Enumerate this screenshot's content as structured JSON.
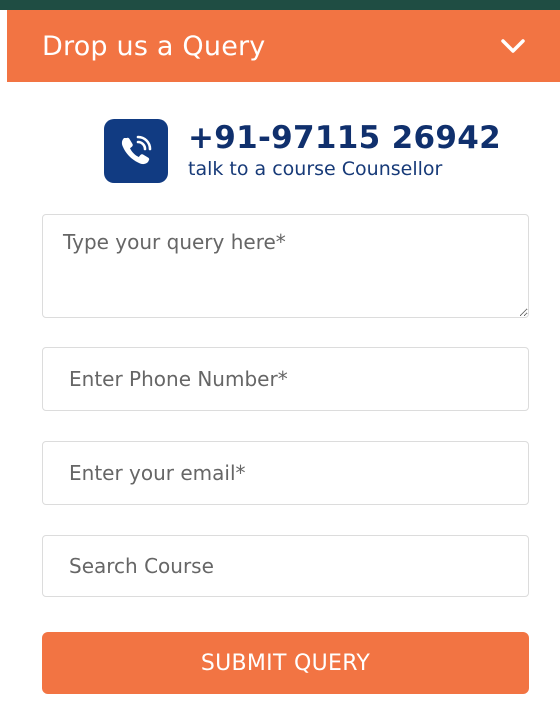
{
  "header": {
    "title": "Drop us a Query",
    "toggle_icon": "chevron-down-icon"
  },
  "contact": {
    "icon": "phone-call-icon",
    "phone_number": "+91-97115 26942",
    "caption": "talk to a course Counsellor"
  },
  "form": {
    "query_placeholder": "Type your query here*",
    "phone_placeholder": "Enter Phone Number*",
    "email_placeholder": "Enter your email*",
    "course_placeholder": "Search Course",
    "submit_label": "SUBMIT QUERY"
  },
  "colors": {
    "accent": "#f27443",
    "brand_blue": "#113b82",
    "top_strip": "#1f4d43"
  }
}
